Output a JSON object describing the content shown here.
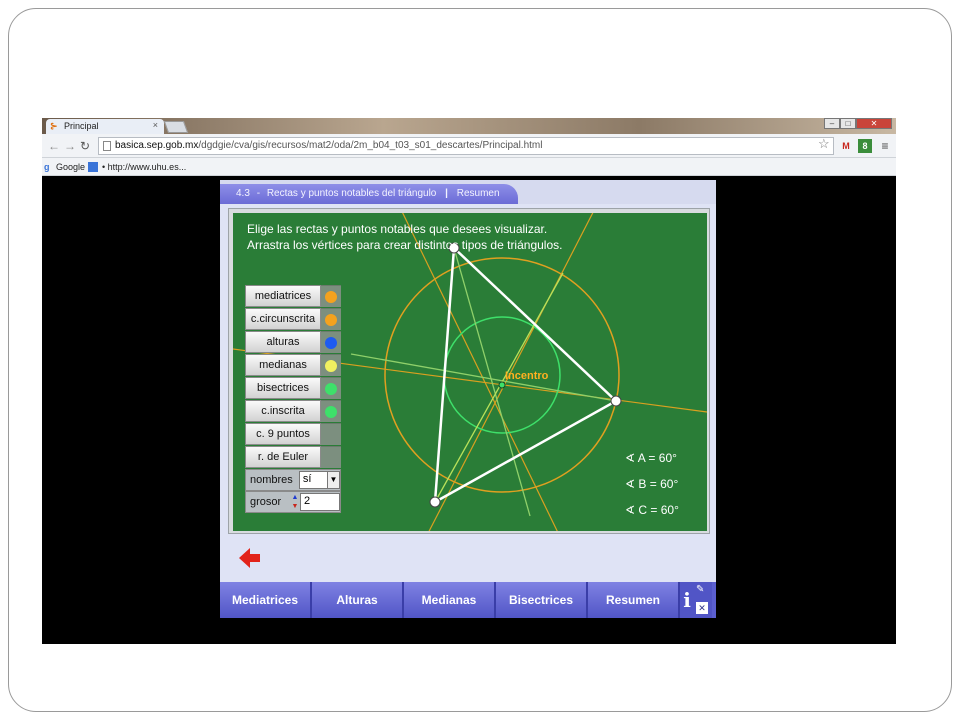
{
  "browser": {
    "tab_title": "Principal",
    "tab_close": "×",
    "url_host": "basica.sep.gob.mx",
    "url_path": "/dgdgie/cva/gis/recursos/mat2/oda/2m_b04_t03_s01_descartes/Principal.html",
    "bookmarks": [
      "Google",
      "• http://www.uhu.es..."
    ],
    "extensions": [
      "M",
      "8"
    ]
  },
  "applet": {
    "header_number": "4.3",
    "header_dash": "-",
    "header_title": "Rectas y puntos notables del triángulo",
    "header_sep": "|",
    "header_link": "Resumen",
    "instructions": [
      "Elige las rectas y puntos notables que desees visualizar.",
      "Arrastra los vértices para crear distintos tipos de triángulos."
    ],
    "panel_items": [
      {
        "label": "mediatrices",
        "color": "#f4a21f"
      },
      {
        "label": "c.circunscrita",
        "color": "#f4a21f"
      },
      {
        "label": "alturas",
        "color": "#1e5bf0"
      },
      {
        "label": "medianas",
        "color": "#f0f060"
      },
      {
        "label": "bisectrices",
        "color": "#3ee06a"
      },
      {
        "label": "c.inscrita",
        "color": "#3ee06a"
      },
      {
        "label": "c. 9 puntos",
        "color": ""
      },
      {
        "label": "r. de Euler",
        "color": ""
      }
    ],
    "nombres_label": "nombres",
    "nombres_value": "sí",
    "grosor_label": "grosor",
    "grosor_value": "2",
    "point_label": "Incentro",
    "angles": [
      {
        "name": "A",
        "value": "60°"
      },
      {
        "name": "B",
        "value": "60°"
      },
      {
        "name": "C",
        "value": "60°"
      }
    ],
    "menu": [
      "Mediatrices",
      "Alturas",
      "Medianas",
      "Bisectrices",
      "Resumen"
    ],
    "info_label": "i",
    "colors": {
      "scene_green": "#2a7d37",
      "menu_blue": "#5b5fd0",
      "back_arrow": "#e2231a",
      "circumcircle": "#e0a020",
      "incircle": "#3ee06a"
    }
  }
}
